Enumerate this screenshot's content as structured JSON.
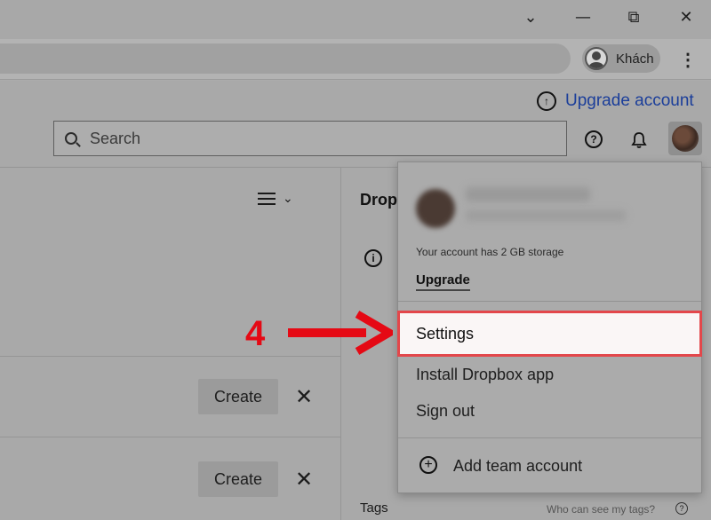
{
  "browser": {
    "controls": {
      "dropdown": "⌄",
      "minimize": "—",
      "restore": "⧉",
      "close": "✕"
    },
    "profile_name": "Khách",
    "menu_glyph": "⋮"
  },
  "header": {
    "upgrade_account": "Upgrade account",
    "search_placeholder": "Search"
  },
  "content": {
    "create_label": "Create",
    "close_glyph": "✕",
    "panel_title": "Drop",
    "tags_label": "Tags",
    "tags_hint": "Who can see my tags?"
  },
  "account_menu": {
    "storage_text": "Your account has 2 GB storage",
    "upgrade": "Upgrade",
    "settings": "Settings",
    "install_app": "Install Dropbox app",
    "sign_out": "Sign out",
    "add_team": "Add team account"
  },
  "annotation": {
    "step": "4",
    "color": "#e50914"
  },
  "colors": {
    "highlight_border": "#e3474b",
    "link": "#1b3e9a"
  }
}
